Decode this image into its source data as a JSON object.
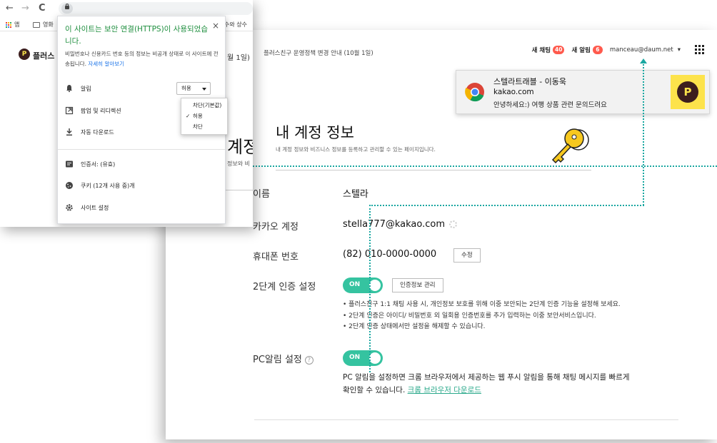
{
  "browser": {
    "nav": {
      "back": "←",
      "forward": "→",
      "reload": "C"
    },
    "bookmarks": [
      {
        "label": "앱"
      },
      {
        "label": "영화"
      },
      {
        "label": "수와 상수"
      }
    ]
  },
  "background_page": {
    "service_name": "플러스",
    "notice_tail": "월 1일)",
    "title_tail": "계정",
    "desc_tail": "정보와 비"
  },
  "site_info_popup": {
    "heading": "이 사이트는 보안 연결(HTTPS)이 사용되었습니다.",
    "close": "×",
    "description": "비밀번호나 신용카드 번호 등의 정보는 비공개 상태로 이 사이트에 전송됩니다.",
    "learn_more": "자세히 알아보기",
    "permissions": [
      {
        "label": "알림",
        "value": "허용"
      },
      {
        "label": "팝업 및 리디렉션"
      },
      {
        "label": "자동 다운로드"
      }
    ],
    "dropdown_options": [
      {
        "label": "차단(기본값)",
        "checked": false
      },
      {
        "label": "허용",
        "checked": true
      },
      {
        "label": "차단",
        "checked": false
      }
    ],
    "footer_items": [
      {
        "label": "인증서: (유효)"
      },
      {
        "label": "쿠키 (12개 사용 중)개"
      },
      {
        "label": "사이트 설정"
      }
    ]
  },
  "header": {
    "notice": "플러스친구 운영정책 변경 안내 (10월 1일)",
    "chat_label": "새 채팅",
    "chat_count": "40",
    "alert_label": "새 알림",
    "alert_count": "6",
    "email": "manceau@daum.net",
    "email_caret": "▾"
  },
  "notification": {
    "title": "스텔라트래블 - 이동욱",
    "site": "kakao.com",
    "message": "안녕하세요:) 여행 상품 관련 문의드려요",
    "logo_letter": "P"
  },
  "account": {
    "title": "내 계정 정보",
    "description": "내 계정 정보와 비즈니스 정보를 등록하고 관리할 수 있는 페이지입니다.",
    "rows": {
      "name": {
        "label": "이름",
        "value": "스텔라"
      },
      "kakao": {
        "label": "카카오 계정",
        "value": "stella777@kakao.com"
      },
      "phone": {
        "label": "휴대폰 번호",
        "value": "(82) 010-0000-0000",
        "button": "수정"
      },
      "two_factor": {
        "label": "2단계 인증 설정",
        "toggle": "ON",
        "button": "인증정보 관리",
        "bullets": [
          "• 플러스친구 1:1 채팅 사용 시, 개인정보 보호를 위해 이중 보안되는 2단계 인증 기능을 설정해 보세요.",
          "• 2단계 인증은 아이디/ 비밀번호 외 일회용 인증번호를 추가 입력하는 이중 보안서비스입니다.",
          "• 2단계 인증 상태에서만 설정을 해제할 수 있습니다."
        ]
      },
      "pc_alert": {
        "label": "PC알림 설정",
        "help": "?",
        "toggle": "ON",
        "desc_line1": "PC 알림을 설정하면 크롬 브라우저에서 제공하는 웹 푸시 알림을 통해 채팅 메시지를 빠르게",
        "desc_line2": "확인할 수 있습니다.",
        "link": "크롬 브라우저 다운로드"
      }
    }
  },
  "colors": {
    "accent": "#35c3a0",
    "badge": "#ff5a4d",
    "kakao_yellow": "#fde34b",
    "annotation": "#1aa7a1",
    "secure_green": "#1e8e3e"
  }
}
